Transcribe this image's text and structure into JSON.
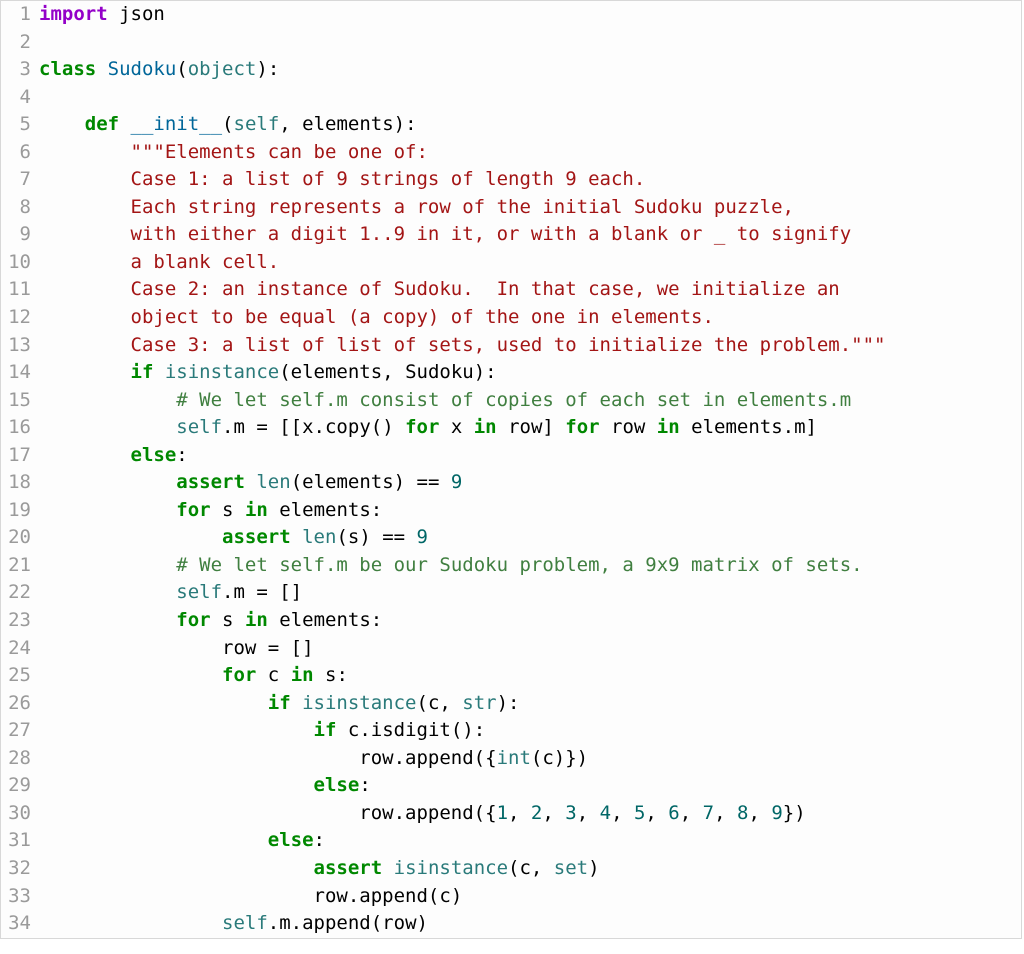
{
  "lines": [
    {
      "n": 1,
      "tokens": [
        [
          "import",
          "tk-import"
        ],
        [
          " json",
          "tk-name"
        ]
      ]
    },
    {
      "n": 2,
      "tokens": [
        [
          "",
          ""
        ]
      ]
    },
    {
      "n": 3,
      "tokens": [
        [
          "class ",
          "tk-kw"
        ],
        [
          "Sudoku",
          "tk-def"
        ],
        [
          "(",
          "tk-op"
        ],
        [
          "object",
          "tk-builtin"
        ],
        [
          "):",
          "tk-op"
        ]
      ]
    },
    {
      "n": 4,
      "tokens": [
        [
          "",
          ""
        ]
      ]
    },
    {
      "n": 5,
      "tokens": [
        [
          "    ",
          ""
        ],
        [
          "def ",
          "tk-kw"
        ],
        [
          "__init__",
          "tk-def"
        ],
        [
          "(",
          "tk-op"
        ],
        [
          "self",
          "tk-self"
        ],
        [
          ", elements):",
          "tk-op"
        ]
      ]
    },
    {
      "n": 6,
      "tokens": [
        [
          "        ",
          ""
        ],
        [
          "\"\"\"Elements can be one of:",
          "tk-doc"
        ]
      ]
    },
    {
      "n": 7,
      "tokens": [
        [
          "        ",
          ""
        ],
        [
          "Case 1: a list of 9 strings of length 9 each.",
          "tk-doc"
        ]
      ]
    },
    {
      "n": 8,
      "tokens": [
        [
          "        ",
          ""
        ],
        [
          "Each string represents a row of the initial Sudoku puzzle,",
          "tk-doc"
        ]
      ]
    },
    {
      "n": 9,
      "tokens": [
        [
          "        ",
          ""
        ],
        [
          "with either a digit 1..9 in it, or with a blank or _ to signify",
          "tk-doc"
        ]
      ]
    },
    {
      "n": 10,
      "tokens": [
        [
          "        ",
          ""
        ],
        [
          "a blank cell.",
          "tk-doc"
        ]
      ]
    },
    {
      "n": 11,
      "tokens": [
        [
          "        ",
          ""
        ],
        [
          "Case 2: an instance of Sudoku.  In that case, we initialize an",
          "tk-doc"
        ]
      ]
    },
    {
      "n": 12,
      "tokens": [
        [
          "        ",
          ""
        ],
        [
          "object to be equal (a copy) of the one in elements.",
          "tk-doc"
        ]
      ]
    },
    {
      "n": 13,
      "tokens": [
        [
          "        ",
          ""
        ],
        [
          "Case 3: a list of list of sets, used to initialize the problem.\"\"\"",
          "tk-doc"
        ]
      ]
    },
    {
      "n": 14,
      "tokens": [
        [
          "        ",
          ""
        ],
        [
          "if ",
          "tk-kw"
        ],
        [
          "isinstance",
          "tk-builtin"
        ],
        [
          "(elements, Sudoku):",
          "tk-op"
        ]
      ]
    },
    {
      "n": 15,
      "tokens": [
        [
          "            ",
          ""
        ],
        [
          "# We let self.m consist of copies of each set in elements.m",
          "tk-cmt"
        ]
      ]
    },
    {
      "n": 16,
      "tokens": [
        [
          "            ",
          ""
        ],
        [
          "self",
          "tk-self"
        ],
        [
          ".m = [[x.copy() ",
          "tk-op"
        ],
        [
          "for",
          "tk-kw"
        ],
        [
          " x ",
          "tk-op"
        ],
        [
          "in",
          "tk-kw"
        ],
        [
          " row] ",
          "tk-op"
        ],
        [
          "for",
          "tk-kw"
        ],
        [
          " row ",
          "tk-op"
        ],
        [
          "in",
          "tk-kw"
        ],
        [
          " elements.m]",
          "tk-op"
        ]
      ]
    },
    {
      "n": 17,
      "tokens": [
        [
          "        ",
          ""
        ],
        [
          "else",
          "tk-kw"
        ],
        [
          ":",
          "tk-op"
        ]
      ]
    },
    {
      "n": 18,
      "tokens": [
        [
          "            ",
          ""
        ],
        [
          "assert ",
          "tk-kw"
        ],
        [
          "len",
          "tk-builtin"
        ],
        [
          "(elements) == ",
          "tk-op"
        ],
        [
          "9",
          "tk-num"
        ]
      ]
    },
    {
      "n": 19,
      "tokens": [
        [
          "            ",
          ""
        ],
        [
          "for",
          "tk-kw"
        ],
        [
          " s ",
          "tk-op"
        ],
        [
          "in",
          "tk-kw"
        ],
        [
          " elements:",
          "tk-op"
        ]
      ]
    },
    {
      "n": 20,
      "tokens": [
        [
          "                ",
          ""
        ],
        [
          "assert ",
          "tk-kw"
        ],
        [
          "len",
          "tk-builtin"
        ],
        [
          "(s) == ",
          "tk-op"
        ],
        [
          "9",
          "tk-num"
        ]
      ]
    },
    {
      "n": 21,
      "tokens": [
        [
          "            ",
          ""
        ],
        [
          "# We let self.m be our Sudoku problem, a 9x9 matrix of sets.",
          "tk-cmt"
        ]
      ]
    },
    {
      "n": 22,
      "tokens": [
        [
          "            ",
          ""
        ],
        [
          "self",
          "tk-self"
        ],
        [
          ".m = []",
          "tk-op"
        ]
      ]
    },
    {
      "n": 23,
      "tokens": [
        [
          "            ",
          ""
        ],
        [
          "for",
          "tk-kw"
        ],
        [
          " s ",
          "tk-op"
        ],
        [
          "in",
          "tk-kw"
        ],
        [
          " elements:",
          "tk-op"
        ]
      ]
    },
    {
      "n": 24,
      "tokens": [
        [
          "                ",
          ""
        ],
        [
          "row = []",
          "tk-op"
        ]
      ]
    },
    {
      "n": 25,
      "tokens": [
        [
          "                ",
          ""
        ],
        [
          "for",
          "tk-kw"
        ],
        [
          " c ",
          "tk-op"
        ],
        [
          "in",
          "tk-kw"
        ],
        [
          " s:",
          "tk-op"
        ]
      ]
    },
    {
      "n": 26,
      "tokens": [
        [
          "                    ",
          ""
        ],
        [
          "if ",
          "tk-kw"
        ],
        [
          "isinstance",
          "tk-builtin"
        ],
        [
          "(c, ",
          "tk-op"
        ],
        [
          "str",
          "tk-builtin"
        ],
        [
          "):",
          "tk-op"
        ]
      ]
    },
    {
      "n": 27,
      "tokens": [
        [
          "                        ",
          ""
        ],
        [
          "if ",
          "tk-kw"
        ],
        [
          "c.isdigit():",
          "tk-op"
        ]
      ]
    },
    {
      "n": 28,
      "tokens": [
        [
          "                            ",
          ""
        ],
        [
          "row.append({",
          "tk-op"
        ],
        [
          "int",
          "tk-builtin"
        ],
        [
          "(c)})",
          "tk-op"
        ]
      ]
    },
    {
      "n": 29,
      "tokens": [
        [
          "                        ",
          ""
        ],
        [
          "else",
          "tk-kw"
        ],
        [
          ":",
          "tk-op"
        ]
      ]
    },
    {
      "n": 30,
      "tokens": [
        [
          "                            ",
          ""
        ],
        [
          "row.append({",
          "tk-op"
        ],
        [
          "1",
          "tk-num"
        ],
        [
          ", ",
          "tk-op"
        ],
        [
          "2",
          "tk-num"
        ],
        [
          ", ",
          "tk-op"
        ],
        [
          "3",
          "tk-num"
        ],
        [
          ", ",
          "tk-op"
        ],
        [
          "4",
          "tk-num"
        ],
        [
          ", ",
          "tk-op"
        ],
        [
          "5",
          "tk-num"
        ],
        [
          ", ",
          "tk-op"
        ],
        [
          "6",
          "tk-num"
        ],
        [
          ", ",
          "tk-op"
        ],
        [
          "7",
          "tk-num"
        ],
        [
          ", ",
          "tk-op"
        ],
        [
          "8",
          "tk-num"
        ],
        [
          ", ",
          "tk-op"
        ],
        [
          "9",
          "tk-num"
        ],
        [
          "})",
          "tk-op"
        ]
      ]
    },
    {
      "n": 31,
      "tokens": [
        [
          "                    ",
          ""
        ],
        [
          "else",
          "tk-kw"
        ],
        [
          ":",
          "tk-op"
        ]
      ]
    },
    {
      "n": 32,
      "tokens": [
        [
          "                        ",
          ""
        ],
        [
          "assert ",
          "tk-kw"
        ],
        [
          "isinstance",
          "tk-builtin"
        ],
        [
          "(c, ",
          "tk-op"
        ],
        [
          "set",
          "tk-builtin"
        ],
        [
          ")",
          "tk-op"
        ]
      ]
    },
    {
      "n": 33,
      "tokens": [
        [
          "                        ",
          ""
        ],
        [
          "row.append(c)",
          "tk-op"
        ]
      ]
    },
    {
      "n": 34,
      "tokens": [
        [
          "                ",
          ""
        ],
        [
          "self",
          "tk-self"
        ],
        [
          ".m.append(row)",
          "tk-op"
        ]
      ]
    }
  ]
}
